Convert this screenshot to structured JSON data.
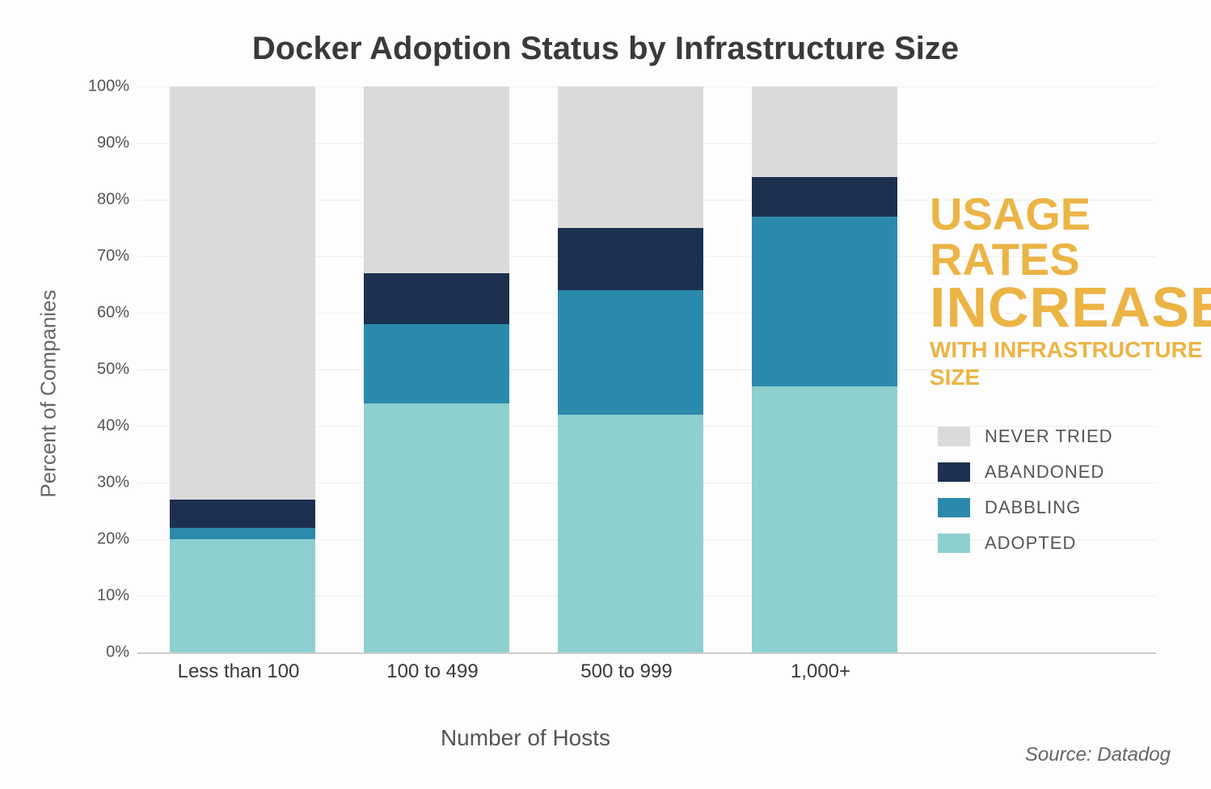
{
  "chart_data": {
    "type": "bar",
    "title": "Docker Adoption Status by Infrastructure Size",
    "xlabel": "Number of Hosts",
    "ylabel": "Percent of Companies",
    "ylim": [
      0,
      100
    ],
    "yticks": [
      0,
      10,
      20,
      30,
      40,
      50,
      60,
      70,
      80,
      90,
      100
    ],
    "ytick_labels": [
      "0%",
      "10%",
      "20%",
      "30%",
      "40%",
      "50%",
      "60%",
      "70%",
      "80%",
      "90%",
      "100%"
    ],
    "categories": [
      "Less than 100",
      "100 to 499",
      "500 to 999",
      "1,000+"
    ],
    "series": [
      {
        "name": "ADOPTED",
        "color": "#8ecfd0",
        "values": [
          20,
          44,
          42,
          47
        ]
      },
      {
        "name": "DABBLING",
        "color": "#2b8aab",
        "values": [
          2,
          14,
          22,
          30
        ]
      },
      {
        "name": "ABANDONED",
        "color": "#1c3150",
        "values": [
          5,
          9,
          11,
          7
        ]
      },
      {
        "name": "NEVER TRIED",
        "color": "#dadada",
        "values": [
          73,
          33,
          25,
          16
        ]
      }
    ],
    "annotation": {
      "line1": "USAGE RATES",
      "line2": "INCREASE",
      "line3": "WITH INFRASTRUCTURE SIZE"
    },
    "legend_order": [
      "NEVER TRIED",
      "ABANDONED",
      "DABBLING",
      "ADOPTED"
    ],
    "source": "Source: Datadog"
  }
}
